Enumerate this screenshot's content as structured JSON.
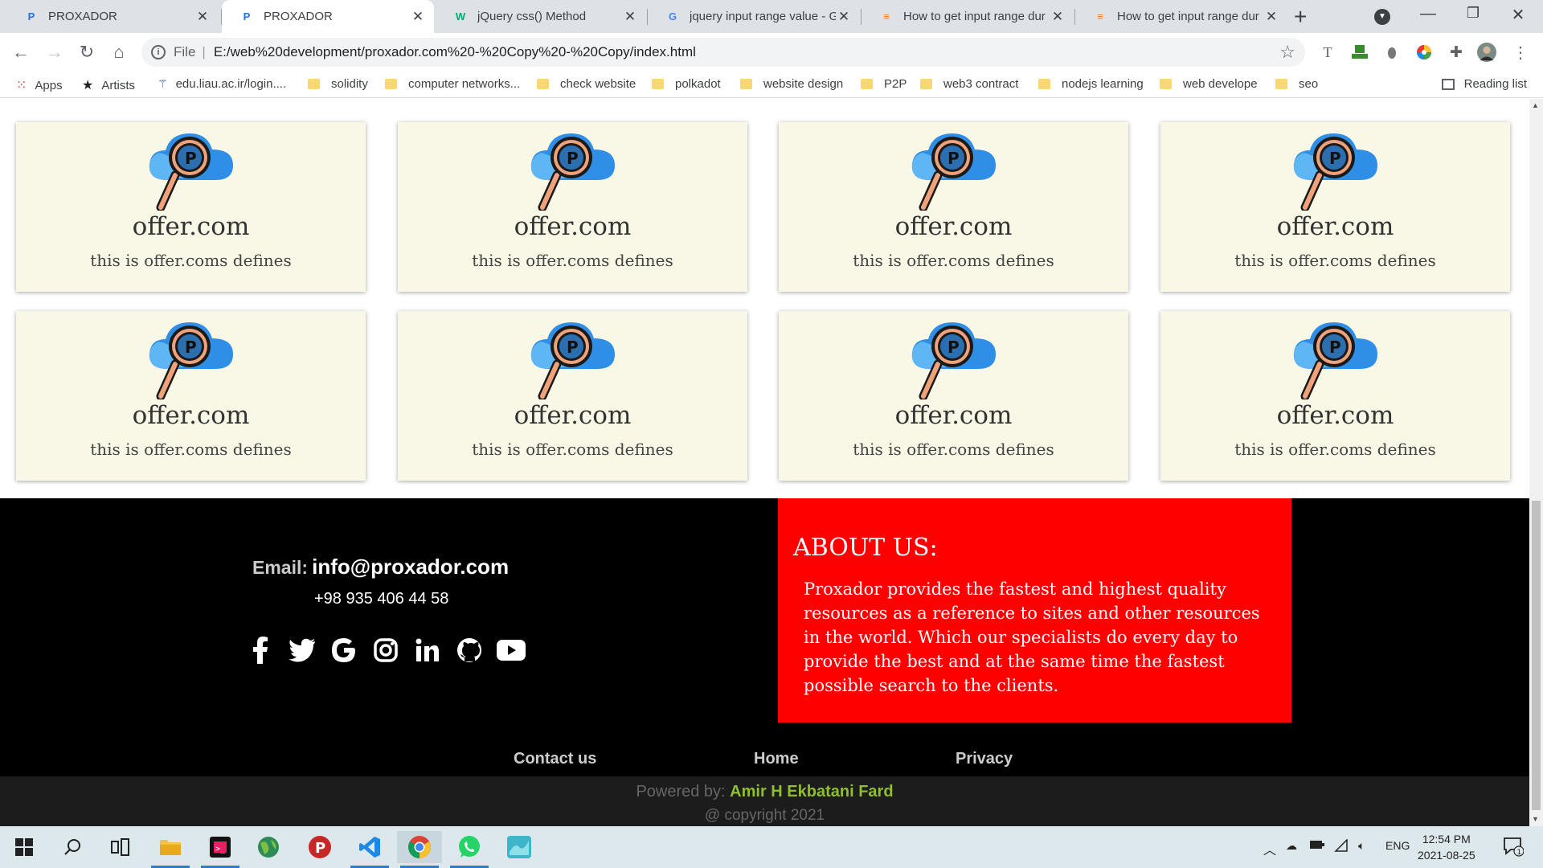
{
  "browser": {
    "tabs": [
      {
        "title": "PROXADOR",
        "favicon": "proxador-icon"
      },
      {
        "title": "PROXADOR",
        "favicon": "proxador-icon"
      },
      {
        "title": "jQuery css() Method",
        "favicon": "w3schools-icon"
      },
      {
        "title": "jquery input range value - G",
        "favicon": "google-icon"
      },
      {
        "title": "How to get input range dur",
        "favicon": "stackoverflow-icon"
      },
      {
        "title": "How to get input range dur",
        "favicon": "stackoverflow-icon"
      }
    ],
    "active_tab_index": 1,
    "omnibox": {
      "scheme": "File",
      "url": "E:/web%20development/proxador.com%20-%20Copy%20-%20Copy/index.html"
    },
    "bookmarks": [
      {
        "label": "Apps",
        "icon": "apps-grid-icon"
      },
      {
        "label": "Artists",
        "icon": "star-icon"
      },
      {
        "label": "edu.liau.ac.ir/login....",
        "icon": "university-icon"
      },
      {
        "label": "solidity",
        "icon": "folder-icon"
      },
      {
        "label": "computer networks...",
        "icon": "folder-icon"
      },
      {
        "label": "check website",
        "icon": "folder-icon"
      },
      {
        "label": "polkadot",
        "icon": "folder-icon"
      },
      {
        "label": "website design",
        "icon": "folder-icon"
      },
      {
        "label": "P2P",
        "icon": "folder-icon"
      },
      {
        "label": "web3 contract",
        "icon": "folder-icon"
      },
      {
        "label": "nodejs learning",
        "icon": "folder-icon"
      },
      {
        "label": "web develope",
        "icon": "folder-icon"
      },
      {
        "label": "seo",
        "icon": "folder-icon"
      }
    ],
    "reading_list": "Reading list"
  },
  "page": {
    "cards": [
      {
        "name": "offer.com",
        "desc": "this is offer.coms defines"
      },
      {
        "name": "offer.com",
        "desc": "this is offer.coms defines"
      },
      {
        "name": "offer.com",
        "desc": "this is offer.coms defines"
      },
      {
        "name": "offer.com",
        "desc": "this is offer.coms defines"
      },
      {
        "name": "offer.com",
        "desc": "this is offer.coms defines"
      },
      {
        "name": "offer.com",
        "desc": "this is offer.coms defines"
      },
      {
        "name": "offer.com",
        "desc": "this is offer.coms defines"
      },
      {
        "name": "offer.com",
        "desc": "this is offer.coms defines"
      }
    ],
    "footer": {
      "email_label": "Email:",
      "email": "info@proxador.com",
      "phone": "+98 935 406 44 58",
      "social": [
        "facebook-icon",
        "twitter-icon",
        "google-icon",
        "instagram-icon",
        "linkedin-icon",
        "github-icon",
        "youtube-icon"
      ],
      "about_title": "ABOUT US:",
      "about_text": "Proxador provides the fastest and highest quality resources as a reference to sites and other resources in the world. Which our specialists do every day to provide the best and at the same time the fastest possible search to the clients.",
      "nav": [
        "Contact us",
        "Home",
        "Privacy"
      ],
      "powered_label": "Powered by:",
      "author": "Amir H Ekbatani Fard",
      "copyright": "@ copyright 2021"
    },
    "colors": {
      "card_bg": "#f9f7e5",
      "about_bg": "#ff0000",
      "footer_bg": "#000000",
      "author": "#8fbf2f"
    }
  },
  "taskbar": {
    "apps": [
      "start-icon",
      "search-icon",
      "task-view-icon",
      "file-explorer-icon",
      "terminal-icon",
      "globe-app-icon",
      "proxador-app-icon",
      "vscode-icon",
      "chrome-icon",
      "whatsapp-icon",
      "mail-app-icon"
    ],
    "language": "ENG",
    "time": "12:54 PM",
    "date": "2021-08-25",
    "notifications": "1"
  }
}
